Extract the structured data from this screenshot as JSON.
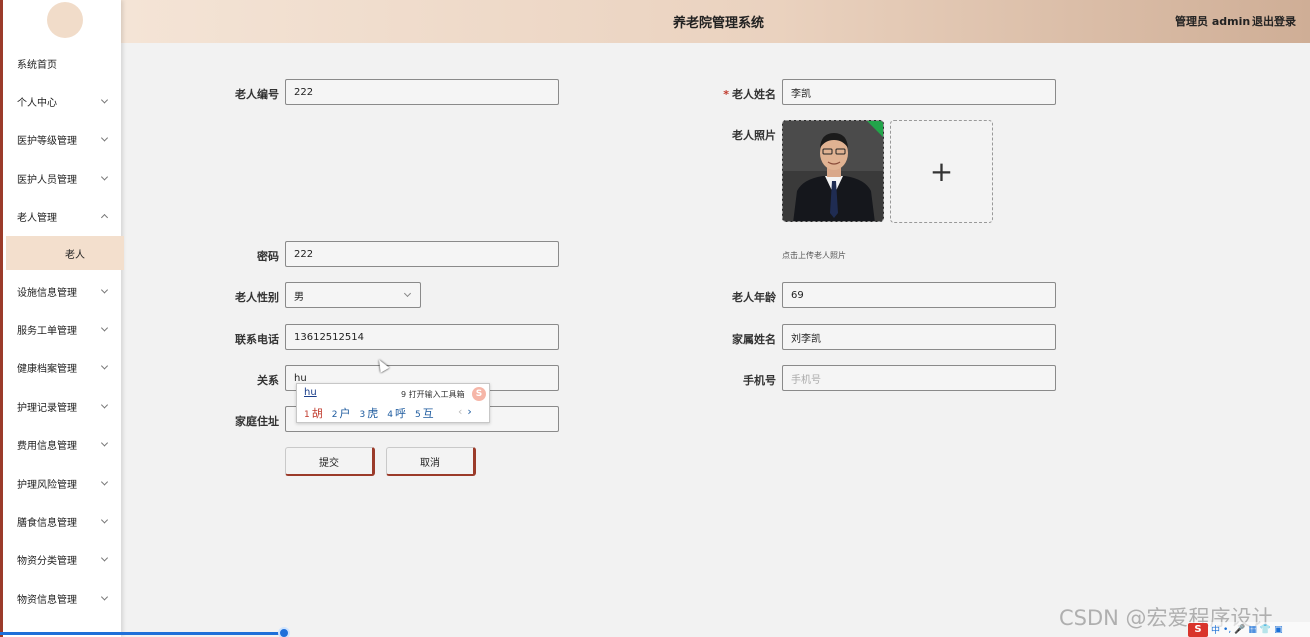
{
  "header": {
    "title": "养老院管理系统",
    "admin_text": "管理员 admin",
    "logout_label": "退出登录"
  },
  "sidebar": {
    "items": [
      {
        "label": "系统首页"
      },
      {
        "label": "个人中心"
      },
      {
        "label": "医护等级管理"
      },
      {
        "label": "医护人员管理"
      },
      {
        "label": "老人管理"
      },
      {
        "label": "老人"
      },
      {
        "label": "设施信息管理"
      },
      {
        "label": "服务工单管理"
      },
      {
        "label": "健康档案管理"
      },
      {
        "label": "护理记录管理"
      },
      {
        "label": "费用信息管理"
      },
      {
        "label": "护理风险管理"
      },
      {
        "label": "膳食信息管理"
      },
      {
        "label": "物资分类管理"
      },
      {
        "label": "物资信息管理"
      }
    ]
  },
  "form": {
    "elder_no_label": "老人编号",
    "elder_no_value": "222",
    "elder_name_required": "*",
    "elder_name_label": "老人姓名",
    "elder_name_value": "李凯",
    "photo_label": "老人照片",
    "upload_plus": "+",
    "upload_hint": "点击上传老人照片",
    "password_label": "密码",
    "password_value": "222",
    "gender_label": "老人性别",
    "gender_value": "男",
    "age_label": "老人年龄",
    "age_value": "69",
    "phone_label": "联系电话",
    "phone_value": "13612512514",
    "family_name_label": "家属姓名",
    "family_name_value": "刘李凯",
    "relation_label": "关系",
    "relation_value": "hu",
    "mobile_label": "手机号",
    "mobile_placeholder": "手机号",
    "address_label": "家庭住址",
    "address_value": "",
    "submit_label": "提交",
    "cancel_label": "取消"
  },
  "ime": {
    "composition": "hu",
    "hint": "9 打开输入工具箱",
    "candidates": [
      {
        "n": "1",
        "text": "胡"
      },
      {
        "n": "2",
        "text": "户"
      },
      {
        "n": "3",
        "text": "虎"
      },
      {
        "n": "4",
        "text": "呼"
      },
      {
        "n": "5",
        "text": "互"
      }
    ],
    "pager_prev": "‹",
    "pager_next": "›",
    "logo": "S"
  },
  "watermark": "CSDN @宏爱程序设计",
  "taskbar": {
    "logo": "S",
    "items": [
      "中",
      "•,",
      "🎤",
      "▦",
      "👕",
      "▣"
    ]
  }
}
